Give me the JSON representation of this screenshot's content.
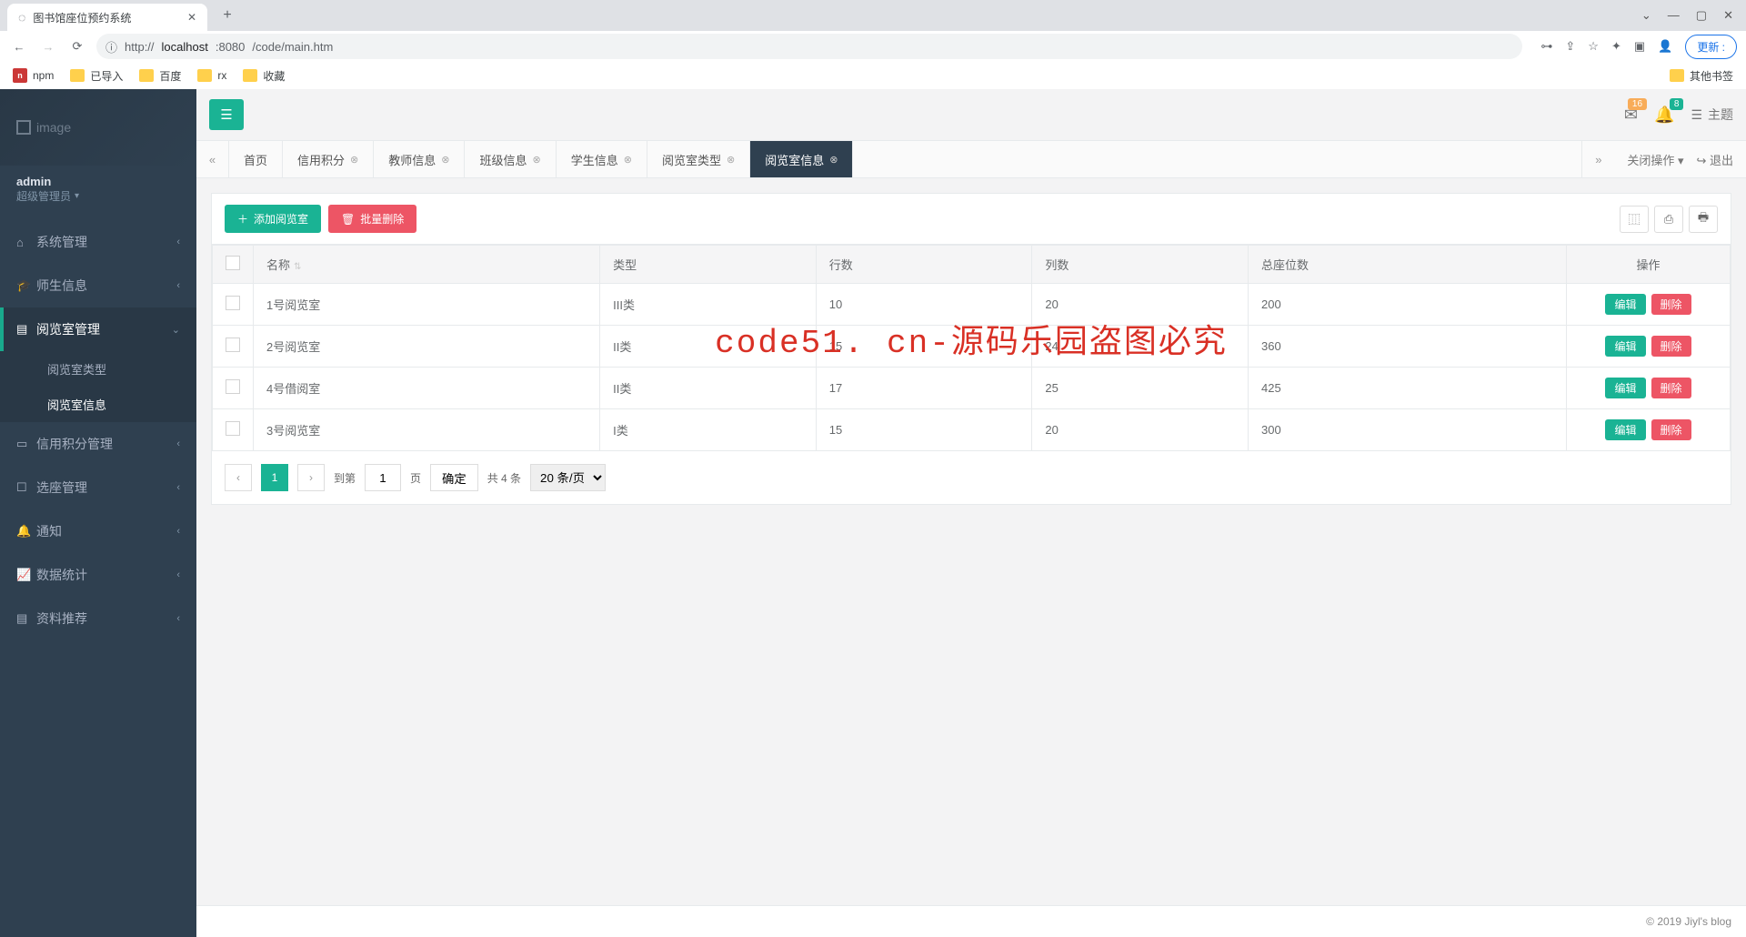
{
  "browser": {
    "tab_title": "图书馆座位预约系统",
    "url_host": "localhost",
    "url_port": ":8080",
    "url_path": "/code/main.htm",
    "url_prefix": "http://",
    "update_btn": "更新 :",
    "bookmarks": {
      "npm": "npm",
      "imported": "已导入",
      "baidu": "百度",
      "rx": "rx",
      "fav": "收藏",
      "other": "其他书签"
    }
  },
  "brand": {
    "text": "image"
  },
  "user": {
    "name": "admin",
    "role": "超级管理员"
  },
  "menu": {
    "sys": "系统管理",
    "teacher": "师生信息",
    "room": "阅览室管理",
    "room_sub1": "阅览室类型",
    "room_sub2": "阅览室信息",
    "credit": "信用积分管理",
    "seat": "选座管理",
    "notify": "通知",
    "stats": "数据统计",
    "recommend": "资料推荐"
  },
  "notif": {
    "count1": "16",
    "count2": "8",
    "theme": "主题"
  },
  "tabs": {
    "home": "首页",
    "credit": "信用积分",
    "teacher": "教师信息",
    "class": "班级信息",
    "student": "学生信息",
    "roomtype": "阅览室类型",
    "roominfo": "阅览室信息",
    "close_ops": "关闭操作",
    "logout": "退出"
  },
  "toolbar": {
    "add": "添加阅览室",
    "batch_del": "批量删除"
  },
  "table": {
    "h_name": "名称",
    "h_type": "类型",
    "h_rows": "行数",
    "h_cols": "列数",
    "h_total": "总座位数",
    "h_ops": "操作",
    "edit": "编辑",
    "del": "删除",
    "rows": [
      {
        "name": "1号阅览室",
        "type": "III类",
        "rows": "10",
        "cols": "20",
        "total": "200"
      },
      {
        "name": "2号阅览室",
        "type": "II类",
        "rows": "15",
        "cols": "24",
        "total": "360"
      },
      {
        "name": "4号借阅室",
        "type": "II类",
        "rows": "17",
        "cols": "25",
        "total": "425"
      },
      {
        "name": "3号阅览室",
        "type": "I类",
        "rows": "15",
        "cols": "20",
        "total": "300"
      }
    ]
  },
  "pager": {
    "current": "1",
    "goto": "到第",
    "page_input": "1",
    "page_suffix": "页",
    "confirm": "确定",
    "total": "共 4 条",
    "pagesize": "20 条/页"
  },
  "footer": "© 2019 Jiyl's blog",
  "watermark": "code51. cn-源码乐园盗图必究"
}
